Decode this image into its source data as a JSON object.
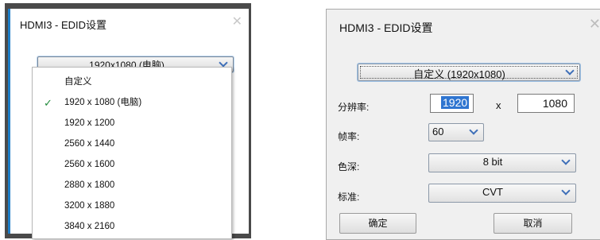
{
  "left_dialog": {
    "title": "HDMI3 - EDID设置",
    "close_glyph": "✕",
    "preset_select": {
      "selected": "1920x1080 (电脑)"
    },
    "dropdown": {
      "options": [
        {
          "label": "自定义",
          "checked": false
        },
        {
          "label": "1920 x 1080 (电脑)",
          "checked": true
        },
        {
          "label": "1920 x 1200",
          "checked": false
        },
        {
          "label": "2560 x 1440",
          "checked": false
        },
        {
          "label": "2560 x 1600",
          "checked": false
        },
        {
          "label": "2880 x 1800",
          "checked": false
        },
        {
          "label": "3200 x 1880",
          "checked": false
        },
        {
          "label": "3840 x 2160",
          "checked": false
        }
      ],
      "check_glyph": "✓"
    }
  },
  "right_dialog": {
    "title": "HDMI3 - EDID设置",
    "close_glyph": "✕",
    "preset_select": {
      "selected": "自定义 (1920x1080)"
    },
    "resolution": {
      "label": "分辨率:",
      "width": "1920",
      "separator": "x",
      "height": "1080"
    },
    "frame_rate": {
      "label": "帧率:",
      "value": "60"
    },
    "color_depth": {
      "label": "色深:",
      "value": "8 bit"
    },
    "standard": {
      "label": "标准:",
      "value": "CVT"
    },
    "buttons": {
      "ok": "确定",
      "cancel": "取消"
    }
  },
  "colors": {
    "accent": "#1e7ec8",
    "selection": "#2f75d0",
    "check": "#1f8a3a",
    "backdrop": "#4a4a4a"
  }
}
